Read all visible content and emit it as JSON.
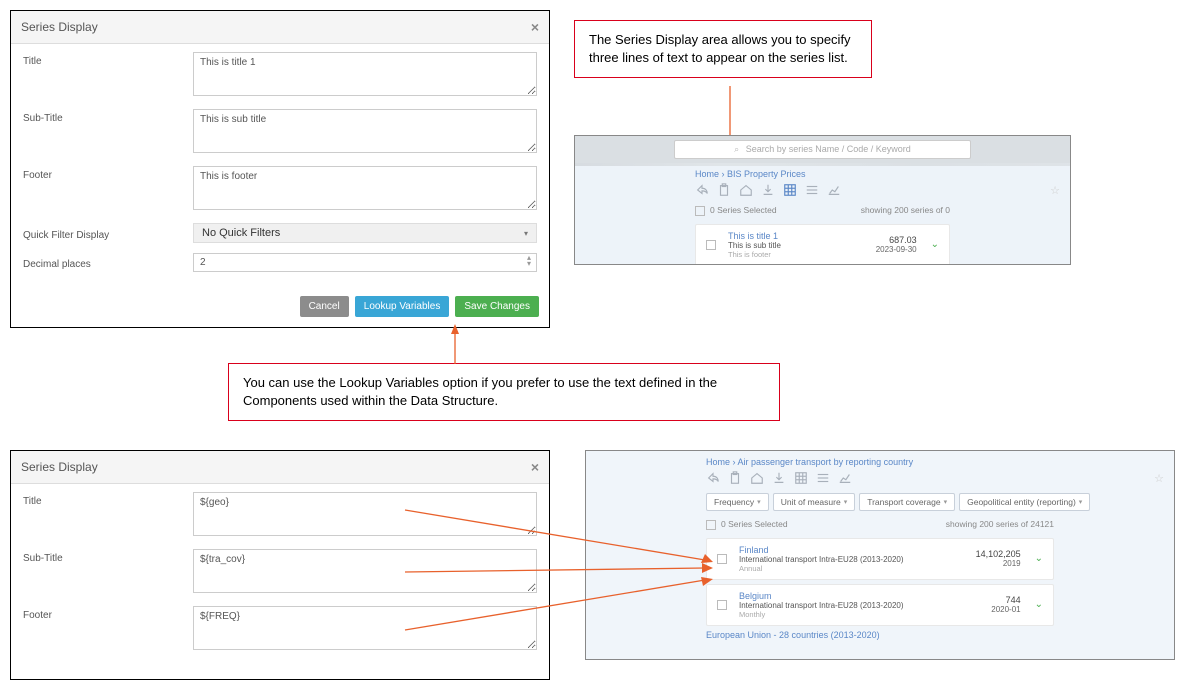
{
  "dialog1": {
    "title": "Series Display",
    "fields": {
      "title_label": "Title",
      "title_value": "This is title 1",
      "subtitle_label": "Sub-Title",
      "subtitle_value": "This is sub title",
      "footer_label": "Footer",
      "footer_value": "This is footer",
      "qf_label": "Quick Filter Display",
      "qf_value": "No Quick Filters",
      "dp_label": "Decimal places",
      "dp_value": "2"
    },
    "buttons": {
      "cancel": "Cancel",
      "lookup": "Lookup Variables",
      "save": "Save Changes"
    }
  },
  "callout1": "The Series Display area allows you to specify three lines of text to appear on the series list.",
  "callout2": "You can use the Lookup Variables option if you prefer to use the text defined in the Components used within the Data Structure.",
  "preview1": {
    "search_placeholder": "Search by series Name / Code / Keyword",
    "crumb_home": "Home",
    "crumb_sep": " › ",
    "crumb_page": "BIS Property Prices",
    "selected_text": "0 Series Selected",
    "showing_text": "showing 200 series of 0",
    "row": {
      "title": "This is title 1",
      "subtitle": "This is sub title",
      "footer": "This is footer",
      "value": "687.03",
      "date": "2023-09-30"
    }
  },
  "dialog2": {
    "title": "Series Display",
    "fields": {
      "title_label": "Title",
      "title_value": "${geo}",
      "subtitle_label": "Sub-Title",
      "subtitle_value": "${tra_cov}",
      "footer_label": "Footer",
      "footer_value": "${FREQ}"
    }
  },
  "preview2": {
    "crumb_home": "Home",
    "crumb_sep": " › ",
    "crumb_page": "Air passenger transport by reporting country",
    "filters": [
      "Frequency",
      "Unit of measure",
      "Transport coverage",
      "Geopolitical entity (reporting)"
    ],
    "selected_text": "0 Series Selected",
    "showing_text": "showing 200 series of 24121",
    "rows": [
      {
        "title": "Finland",
        "subtitle": "International transport Intra-EU28 (2013-2020)",
        "footer": "Annual",
        "value": "14,102,205",
        "date": "2019"
      },
      {
        "title": "Belgium",
        "subtitle": "International transport Intra-EU28 (2013-2020)",
        "footer": "Monthly",
        "value": "744",
        "date": "2020-01"
      }
    ],
    "truncated_row": "European Union - 28 countries (2013-2020)"
  }
}
